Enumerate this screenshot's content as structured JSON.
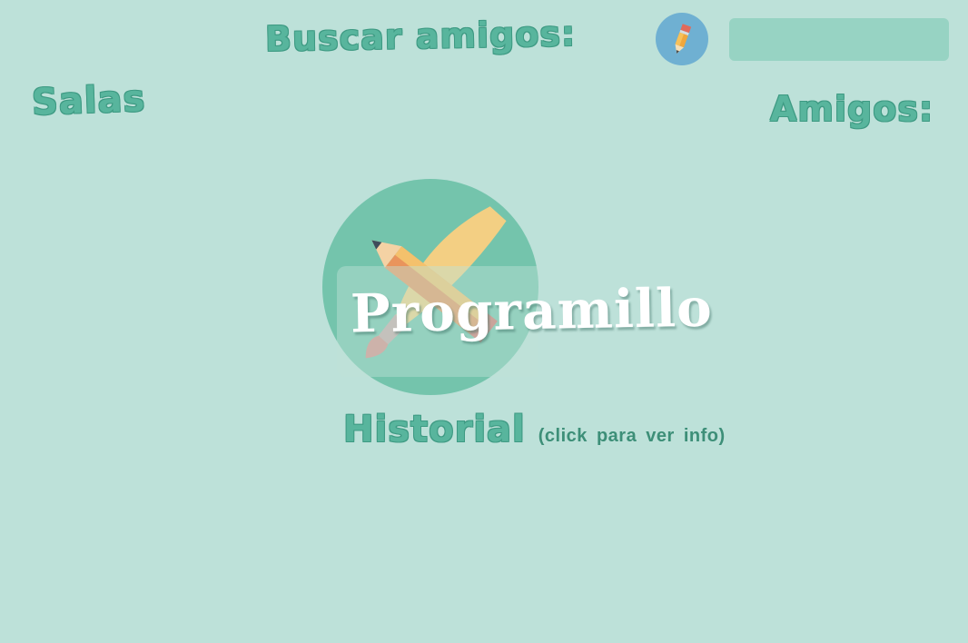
{
  "header": {
    "search_title": "Buscar amigos:",
    "search_input_value": "",
    "edit_icon": "pencil-icon"
  },
  "left_panel": {
    "title": "Salas"
  },
  "right_panel": {
    "title": "Amigos:"
  },
  "main": {
    "logo_icon": "crossed-pencil-brush-logo",
    "brand_name": "Programillo",
    "history_title": "Historial",
    "history_hint": "(click para ver info)"
  },
  "colors": {
    "background": "#bde1d9",
    "heading": "#58b59d",
    "heading_outline": "#3e9a83",
    "logo_circle": "#74c4ac",
    "edit_button": "#6fb0d2",
    "search_field": "#97d3c3",
    "brand_text": "#ffffff"
  }
}
